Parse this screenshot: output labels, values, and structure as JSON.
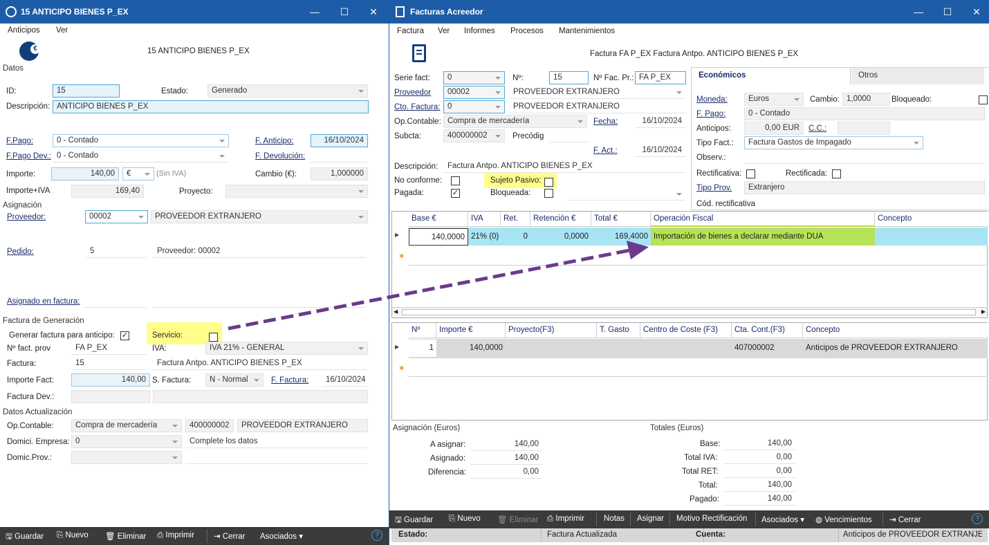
{
  "left": {
    "title": "15 ANTICIPO BIENES P_EX",
    "menu": [
      "Anticipos",
      "Ver"
    ],
    "header_title": "15 ANTICIPO BIENES P_EX",
    "sec_datos": "Datos",
    "id_label": "ID:",
    "id_value": "15",
    "estado_label": "Estado:",
    "estado_value": "Generado",
    "desc_label": "Descripción:",
    "desc_value": "ANTICIPO BIENES P_EX",
    "fpago_label": "F.Pago:",
    "fpago_value": "0 - Contado",
    "fanticipo_label": "F. Anticipo:",
    "fanticipo_value": "16/10/2024",
    "fpagodev_label": "F.Pago Dev.:",
    "fpagodev_value": "0 - Contado",
    "fdevol_label": "F. Devolución:",
    "importe_label": "Importe:",
    "importe_value": "140,00",
    "currency": "€",
    "sin_iva": "(Sin IVA)",
    "cambio_label": "Cambio (€):",
    "cambio_value": "1,000000",
    "importeiva_label": "Importe+IVA",
    "importeiva_value": "169,40",
    "proyecto_label": "Proyecto:",
    "sec_asignacion": "Asignación",
    "proveedor_label": "Proveedor:",
    "proveedor_code": "00002",
    "proveedor_name": "PROVEEDOR EXTRANJERO",
    "pedido_label": "Pedido:",
    "pedido_value": "5",
    "pedido_prov": "Proveedor: 00002",
    "asignado_label": "Asignado en factura:",
    "sec_factgen": "Factura de Generación",
    "generar_label": "Generar factura para anticipo:",
    "generar_checked": "✓",
    "servicio_label": "Servicio:",
    "nfact_label": "Nº fact. prov",
    "nfact_value": "FA P_EX",
    "iva_label": "IVA:",
    "iva_value": "IVA 21% - GENERAL",
    "factura_label": "Factura:",
    "factura_value": "15",
    "factura_desc": "Factura Antpo. ANTICIPO BIENES P_EX",
    "impfact_label": "Importe Fact:",
    "impfact_value": "140,00",
    "sfactura_label": "S. Factura:",
    "sfactura_value": "N - Normal",
    "ffactura_label": "F. Factura:",
    "ffactura_value": "16/10/2024",
    "factdev_label": "Factura Dev.:",
    "sec_datosact": "Datos Actualización",
    "opcont_label": "Op.Contable:",
    "opcont_value": "Compra de mercadería",
    "opcont_code": "400000002",
    "opcont_name": "PROVEEDOR EXTRANJERO",
    "domemp_label": "Domici. Empresa:",
    "domemp_value": "0",
    "domemp_msg": "Complete los datos",
    "domprov_label": "Domic.Prov.:",
    "buttons": {
      "guardar": "Guardar",
      "nuevo": "Nuevo",
      "eliminar": "Eliminar",
      "imprimir": "Imprimir",
      "cerrar": "Cerrar",
      "asociados": "Asociados"
    }
  },
  "right": {
    "title": "Facturas Acreedor",
    "menu": [
      "Factura",
      "Ver",
      "Informes",
      "Procesos",
      "Mantenimientos"
    ],
    "header_title": "Factura FA P_EX Factura Antpo. ANTICIPO BIENES P_EX",
    "serie_label": "Serie fact:",
    "serie_value": "0",
    "n_label": "Nº:",
    "n_value": "15",
    "nfacpr_label": "Nº Fac. Pr.:",
    "nfacpr_value": "FA P_EX",
    "prov_label": "Proveedor",
    "prov_code": "00002",
    "prov_name": "PROVEEDOR EXTRANJERO",
    "cto_label": "Cto. Factura:",
    "cto_value": "0",
    "cto_name": "PROVEEDOR EXTRANJERO",
    "opcont_label": "Op.Contable:",
    "opcont_value": "Compra de mercadería",
    "fecha_label": "Fecha:",
    "fecha_value": "16/10/2024",
    "subcta_label": "Subcta:",
    "subcta_value": "400000002",
    "precodig_label": "Precódig",
    "fact_label": "F. Act.:",
    "fact_value": "16/10/2024",
    "desc_label": "Descripción:",
    "desc_value": "Factura Antpo. ANTICIPO BIENES P_EX",
    "noconf_label": "No conforme:",
    "sujeto_label": "Sujeto Pasivo:",
    "pagada_label": "Pagada:",
    "pagada_checked": "✓",
    "bloqueada_label": "Bloqueada:",
    "tabs": [
      "Económicos",
      "Otros"
    ],
    "moneda_label": "Moneda:",
    "moneda_value": "Euros",
    "cambio_label": "Cambio:",
    "cambio_value": "1,0000",
    "bloq2_label": "Bloqueado:",
    "fpago_label": "F. Pago:",
    "fpago_value": "0 - Contado",
    "anticipos_label": "Anticipos:",
    "anticipos_value": "0,00 EUR",
    "cc_label": "C.C.:",
    "tipofact_label": "Tipo Fact.:",
    "tipofact_value": "Factura Gastos de Impagado",
    "observ_label": "Observ.:",
    "rectificativa_label": "Rectificativa:",
    "rectificada_label": "Rectificada:",
    "tipoprov_label": "Tipo Prov.",
    "tipoprov_value": "Extranjero",
    "codrect_label": "Cód. rectificativa",
    "grid1_headers": [
      "Base €",
      "IVA",
      "Ret.",
      "Retención €",
      "Total €",
      "Operación Fiscal",
      "Concepto"
    ],
    "grid1_row": [
      "140,0000",
      "21% (0)",
      "0",
      "0,0000",
      "169,4000",
      "Importación de bienes a declarar mediante DUA",
      ""
    ],
    "grid2_headers": [
      "Nº",
      "Importe €",
      "Proyecto(F3)",
      "T. Gasto",
      "Centro de Coste (F3)",
      "Cta. Cont.(F3)",
      "Concepto"
    ],
    "grid2_row": [
      "1",
      "140,0000",
      "",
      "",
      "",
      "407000002",
      "Anticipos de PROVEEDOR EXTRANJERO"
    ],
    "asig_title": "Asignación (Euros)",
    "a_asignar_label": "A asignar:",
    "a_asignar_value": "140,00",
    "asignado_label": "Asignado:",
    "asignado_value": "140,00",
    "diferencia_label": "Diferencia:",
    "diferencia_value": "0,00",
    "tot_title": "Totales (Euros)",
    "base_label": "Base:",
    "base_value": "140,00",
    "totiva_label": "Total IVA:",
    "totiva_value": "0,00",
    "totret_label": "Total RET:",
    "totret_value": "0,00",
    "total_label": "Total:",
    "total_value": "140,00",
    "pagado_label": "Pagado:",
    "pagado_value": "140,00",
    "buttons": {
      "guardar": "Guardar",
      "nuevo": "Nuevo",
      "eliminar": "Eliminar",
      "imprimir": "Imprimir",
      "notas": "Notas",
      "asignar": "Asignar",
      "motivo": "Motivo Rectificación",
      "asociados": "Asociados",
      "vencimientos": "Vencimientos",
      "cerrar": "Cerrar"
    },
    "estado_label": "Estado:",
    "estado_value": "Factura Actualizada",
    "cuenta_label": "Cuenta:",
    "cuenta_value": "Anticipos de PROVEEDOR EXTRANJEI"
  },
  "colors": {
    "titlebar": "#1d5da8",
    "highlight": "#fffe8a",
    "row_cyan": "#a8e4f4",
    "op_green": "#b7e356",
    "arrow": "#6b3a8c"
  }
}
